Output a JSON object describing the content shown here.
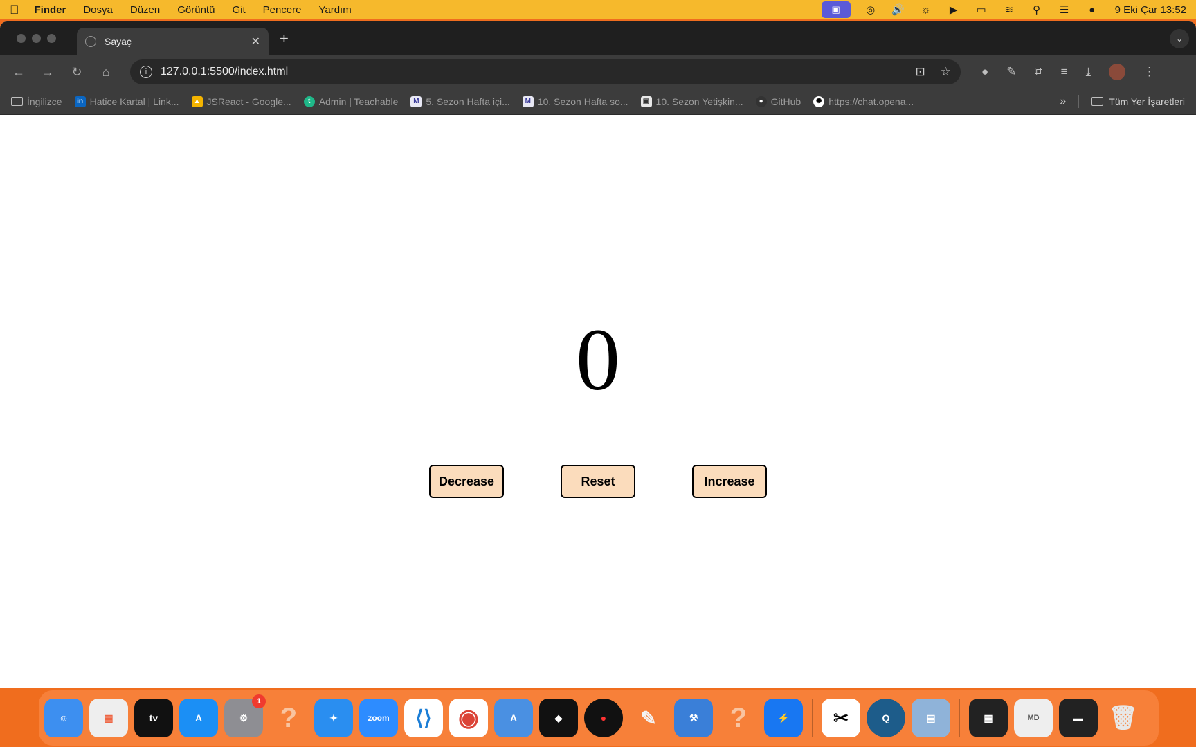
{
  "menubar": {
    "app_name": "Finder",
    "menus": [
      "Dosya",
      "Düzen",
      "Görüntü",
      "Git",
      "Pencere",
      "Yardım"
    ],
    "clock": "9 Eki Çar  13:52"
  },
  "browser": {
    "tab_title": "Sayaç",
    "url": "127.0.0.1:5500/index.html",
    "bookmarks": [
      {
        "label": "İngilizce",
        "icon": "folder-icon"
      },
      {
        "label": "Hatice Kartal | Link...",
        "icon": "linkedin-icon"
      },
      {
        "label": "JSReact - Google...",
        "icon": "google-drive-icon"
      },
      {
        "label": "Admin | Teachable",
        "icon": "teachable-icon"
      },
      {
        "label": "5. Sezon Hafta içi...",
        "icon": "class-icon"
      },
      {
        "label": "10. Sezon Hafta so...",
        "icon": "class-icon"
      },
      {
        "label": "10. Sezon Yetişkin...",
        "icon": "class-icon"
      },
      {
        "label": "GitHub",
        "icon": "github-icon"
      },
      {
        "label": "https://chat.opena...",
        "icon": "openai-icon"
      }
    ],
    "all_bookmarks": "Tüm Yer İşaretleri"
  },
  "counter": {
    "value": "0",
    "buttons": {
      "decrease": "Decrease",
      "reset": "Reset",
      "increase": "Increase"
    }
  },
  "dock": {
    "settings_badge": "1",
    "zoom_label": "zoom"
  },
  "colors": {
    "button_bg": "#fbdcbc",
    "menubar_bg": "#f6b92c",
    "desktop_bg": "#f06d1e"
  }
}
